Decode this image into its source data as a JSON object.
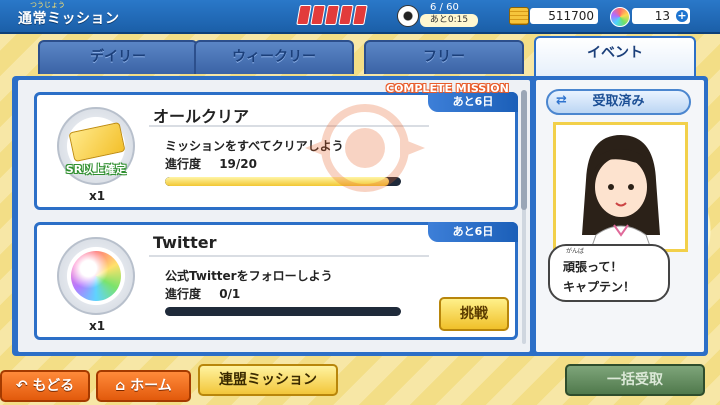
{
  "header": {
    "ruby": "つうじょう",
    "title": "通常ミッション",
    "stamina": {
      "count": 5
    },
    "ball": {
      "count": "6 / 60",
      "timer": "あと0:15"
    },
    "coins": "511700",
    "gems": "13"
  },
  "tabs": [
    {
      "label": "デイリー",
      "active": false
    },
    {
      "label": "ウィークリー",
      "active": false
    },
    {
      "label": "フリー",
      "active": false
    },
    {
      "label": "イベント",
      "active": true
    }
  ],
  "complete_ribbon": "COMPLETE MISSION",
  "missions": [
    {
      "title": "オールクリア",
      "deadline": "あと6日",
      "description": "ミッションをすべてクリアしよう",
      "progress_label": "進行度",
      "progress_text": "19/20",
      "progress_fraction": 0.95,
      "reward_label": "SR以上確定",
      "reward_qty": "x1"
    },
    {
      "title": "Twitter",
      "deadline": "あと6日",
      "description": "公式Twitterをフォローしよう",
      "progress_label": "進行度",
      "progress_text": "0/1",
      "progress_fraction": 0,
      "reward_qty": "x1",
      "action_label": "挑戦"
    }
  ],
  "side": {
    "received_label": "受取済み",
    "speech_ruby": "がんば",
    "speech_line1": "頑張って！",
    "speech_line2": "キャプテン！"
  },
  "footer": {
    "back_label": "もどる",
    "home_label": "ホーム",
    "alliance_label": "連盟ミッション",
    "bulk_label": "一括受取"
  },
  "colors": {
    "header_blue": "#1b5fa8",
    "panel_blue": "#2c6fc7",
    "progress_gold": "#f2c733",
    "back_orange": "#e25a0c"
  }
}
